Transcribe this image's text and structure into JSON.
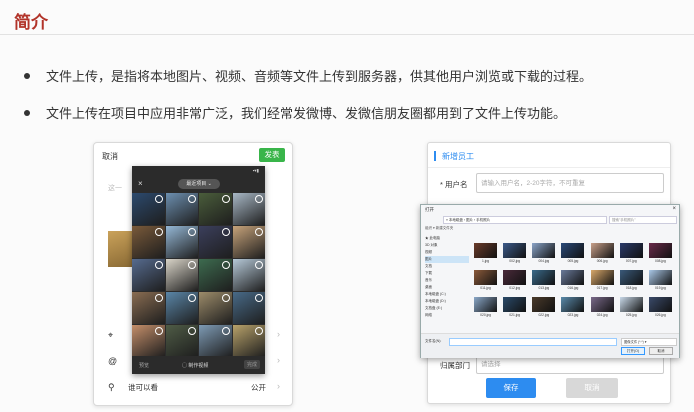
{
  "slide": {
    "title": "简介",
    "bullets": [
      "文件上传，是指将本地图片、视频、音频等文件上传到服务器，供其他用户浏览或下载的过程。",
      "文件上传在项目中应用非常广泛，我们经常发微博、发微信朋友圈都用到了文件上传功能。"
    ]
  },
  "phone": {
    "cancel": "取消",
    "send": "发表",
    "hint": "这一",
    "rows": [
      {
        "icon": "location-icon",
        "label": "",
        "value": ""
      },
      {
        "icon": "at-icon",
        "label": "",
        "value": ""
      },
      {
        "icon": "user-icon",
        "label": "谁可以看",
        "value": "公开"
      }
    ],
    "picker": {
      "close": "×",
      "album": "最近项目 ⌄",
      "status_left": "",
      "status_right": "▪▾▮",
      "footer_preview": "预览",
      "footer_make": "◯ 制作视频",
      "footer_done": "完成",
      "cells": [
        "#2c4a6e",
        "#6c8fb0",
        "#4a5d3b",
        "#a8b8c6",
        "#7a5a3a",
        "#95b8d6",
        "#3b3f5c",
        "#c7a37a",
        "#566b8f",
        "#d9d4c8",
        "#3d6b4f",
        "#b6c9d8",
        "#8a6d52",
        "#5a86a8",
        "#9d8c6a",
        "#486a88",
        "#c58f6a",
        "#4f5c46",
        "#7e9bb5",
        "#b8a26a"
      ]
    }
  },
  "form": {
    "title": "新增员工",
    "username_label": "* 用户名",
    "username_placeholder": "请输入用户名，2-20字符，不可重复",
    "dept_label": "归属部门",
    "dept_placeholder": "请选择",
    "save": "保存",
    "cancel": "取消"
  },
  "dialog": {
    "title": "打开",
    "close": "×",
    "address": "« 本地磁盘 › 图片 › 手机照片",
    "search": "搜索\"手机照片\"",
    "toolbar": "组织 ▾    新建文件夹",
    "nav": [
      "★ 此电脑",
      "3D 对象",
      "视频",
      "图片",
      "文档",
      "下载",
      "音乐",
      "桌面",
      "本地磁盘 (C:)",
      "本地磁盘 (D:)",
      "文档盘 (E:)",
      "网络"
    ],
    "files": [
      {
        "name": "1.jpg",
        "color": "#6a3b2a"
      },
      {
        "name": "002.jpg",
        "color": "#3b5a8a"
      },
      {
        "name": "004.jpg",
        "color": "#8aa4c8"
      },
      {
        "name": "005.jpg",
        "color": "#2a4a7a"
      },
      {
        "name": "006.jpg",
        "color": "#c8a08a"
      },
      {
        "name": "007.jpg",
        "color": "#2a3a6a"
      },
      {
        "name": "008.jpg",
        "color": "#6a2a4a"
      },
      {
        "name": "011.jpg",
        "color": "#8a5a3a"
      },
      {
        "name": "012.jpg",
        "color": "#4a2a3a"
      },
      {
        "name": "013.jpg",
        "color": "#3a6a8a"
      },
      {
        "name": "016.jpg",
        "color": "#6a7a9a"
      },
      {
        "name": "017.jpg",
        "color": "#d8a86a"
      },
      {
        "name": "018.jpg",
        "color": "#3a5a7a"
      },
      {
        "name": "019.jpg",
        "color": "#aac8e8"
      },
      {
        "name": "020.jpg",
        "color": "#8aa8c8"
      },
      {
        "name": "021.jpg",
        "color": "#2a4a6a"
      },
      {
        "name": "022.jpg",
        "color": "#4a3a2a"
      },
      {
        "name": "023.jpg",
        "color": "#5a8aaa"
      },
      {
        "name": "024.jpg",
        "color": "#7a6a8a"
      },
      {
        "name": "025.jpg",
        "color": "#c8d8e8"
      },
      {
        "name": "026.jpg",
        "color": "#3a4a6a"
      }
    ],
    "filename_label": "文件名(N):",
    "file_type": "图像文件 (*.*) ▾",
    "open": "打开(O)",
    "cancel": "取消"
  },
  "colors": {
    "title_red": "#b2342a",
    "accent_blue": "#2d8cf0",
    "send_green": "#39b54a"
  }
}
